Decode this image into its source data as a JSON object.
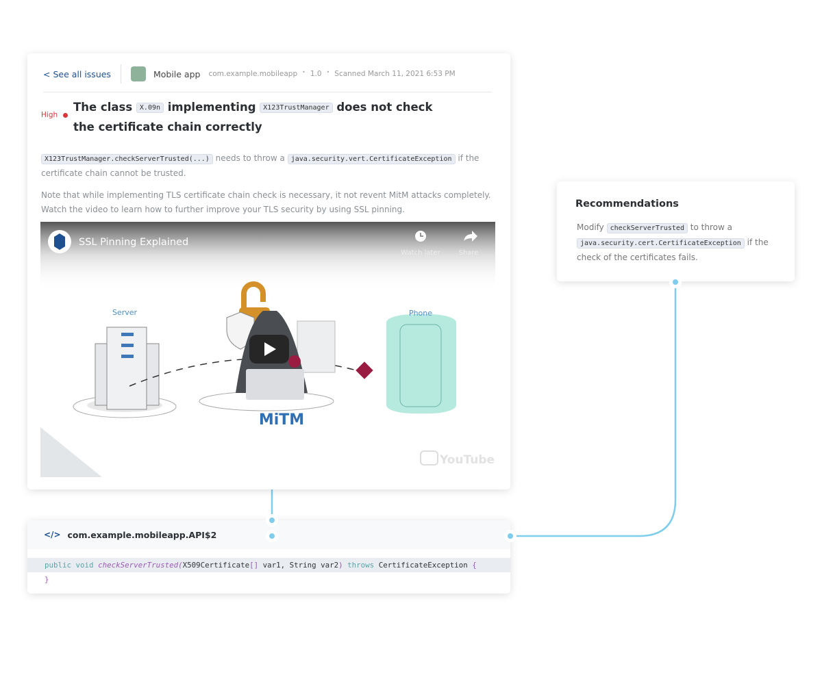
{
  "header": {
    "back_link": "< See all issues",
    "app_name": "Mobile app",
    "package": "com.example.mobileapp",
    "version": "1.0",
    "scanned": "Scanned March 11, 2021 6:53 PM",
    "app_color": "#8fb29a"
  },
  "issue": {
    "severity": "High",
    "severity_color": "#d9363e",
    "title_1": "The class",
    "title_code_1": "X.09n",
    "title_2": "implementing",
    "title_code_2": "X123TrustManager",
    "title_3": "does not check the certificate chain correctly"
  },
  "description": {
    "code_1": "X123TrustManager.checkServerTrusted(...)",
    "text_1": "needs to throw a",
    "code_2": "java.security.vert.CertificateException",
    "text_2": "if the certificate chain cannot be trusted.",
    "note": "Note that while implementing TLS certificate chain check is necessary, it not revent MitM attacks completely. Watch the video to learn how to further improve your TLS security by using SSL pinning."
  },
  "video": {
    "title": "SSL Pinning Explained",
    "watch_later": "Watch later",
    "share": "Share",
    "server_label": "Server",
    "phone_label": "Phone",
    "mitm_label": "MiTM",
    "youtube": "YouTube"
  },
  "code_card": {
    "title": "com.example.mobileapp.API$2",
    "kw_public": "public",
    "kw_void": "void",
    "method": "checkServerTrusted(",
    "params": "X509Certificate",
    "brackets": "[]",
    "rest": " var1, String var2",
    "close_paren": ")",
    "kw_throws": "throws",
    "exception": "CertificateException",
    "open_brace": "{",
    "close_brace": "}"
  },
  "recommendations": {
    "title": "Recommendations",
    "text_1": "Modify",
    "code_1": "checkServerTrusted",
    "text_2": "to throw a",
    "code_2": "java.security.cert.CertificateException",
    "text_3": "if the check of the certificates fails."
  },
  "colors": {
    "connector": "#7fcdec",
    "link": "#1d4f91"
  }
}
